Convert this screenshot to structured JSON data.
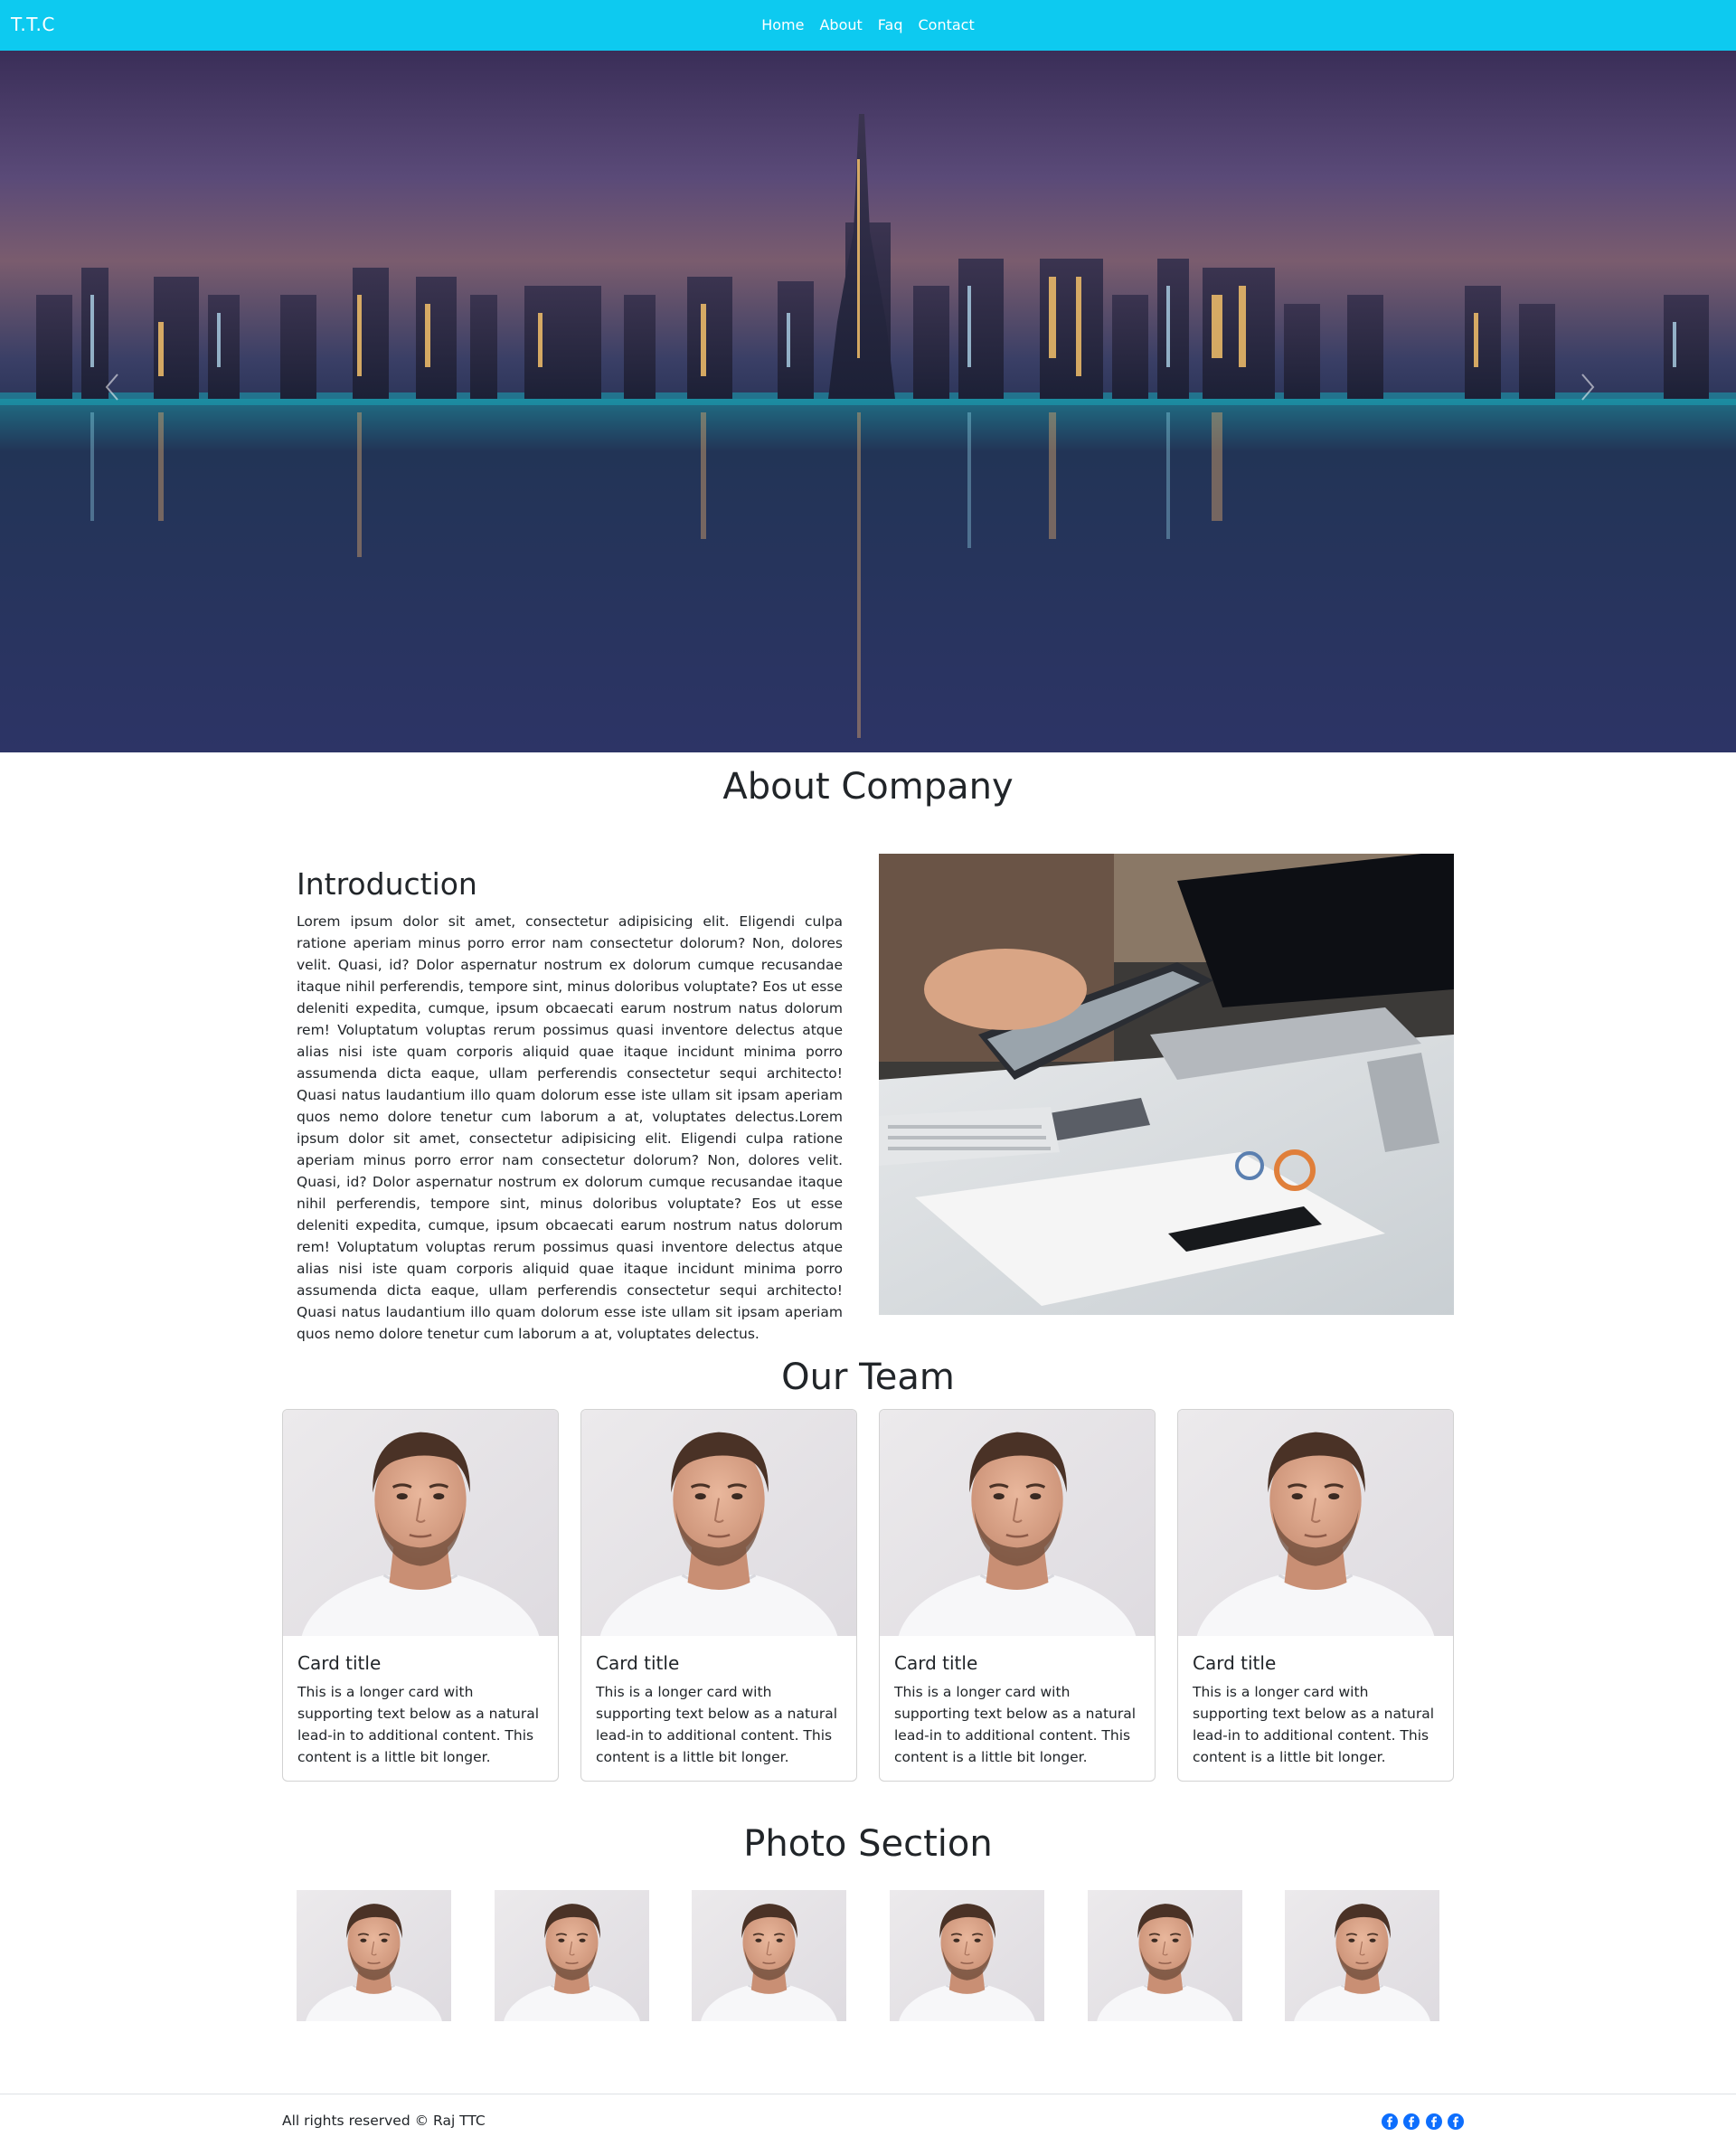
{
  "nav": {
    "brand": "T.T.C",
    "links": [
      "Home",
      "About",
      "Faq",
      "Contact"
    ]
  },
  "hero": {
    "prev_icon": "chevron-left-icon",
    "next_icon": "chevron-right-icon"
  },
  "about": {
    "title": "About Company",
    "intro_heading": "Introduction",
    "intro_text": "Lorem ipsum dolor sit amet, consectetur adipisicing elit. Eligendi culpa ratione aperiam minus porro error nam consectetur dolorum? Non, dolores velit. Quasi, id? Dolor aspernatur nostrum ex dolorum cumque recusandae itaque nihil perferendis, tempore sint, minus doloribus voluptate? Eos ut esse deleniti expedita, cumque, ipsum obcaecati earum nostrum natus dolorum rem! Voluptatum voluptas rerum possimus quasi inventore delectus atque alias nisi iste quam corporis aliquid quae itaque incidunt minima porro assumenda dicta eaque, ullam perferendis consectetur sequi architecto! Quasi natus laudantium illo quam dolorum esse iste ullam sit ipsam aperiam quos nemo dolore tenetur cum laborum a at, voluptates delectus.Lorem ipsum dolor sit amet, consectetur adipisicing elit. Eligendi culpa ratione aperiam minus porro error nam consectetur dolorum? Non, dolores velit. Quasi, id? Dolor aspernatur nostrum ex dolorum cumque recusandae itaque nihil perferendis, tempore sint, minus doloribus voluptate? Eos ut esse deleniti expedita, cumque, ipsum obcaecati earum nostrum natus dolorum rem! Voluptatum voluptas rerum possimus quasi inventore delectus atque alias nisi iste quam corporis aliquid quae itaque incidunt minima porro assumenda dicta eaque, ullam perferendis consectetur sequi architecto! Quasi natus laudantium illo quam dolorum esse iste ullam sit ipsam aperiam quos nemo dolore tenetur cum laborum a at, voluptates delectus."
  },
  "team": {
    "title": "Our Team",
    "cards": [
      {
        "title": "Card title",
        "text": "This is a longer card with supporting text below as a natural lead-in to additional content. This content is a little bit longer."
      },
      {
        "title": "Card title",
        "text": "This is a longer card with supporting text below as a natural lead-in to additional content. This content is a little bit longer."
      },
      {
        "title": "Card title",
        "text": "This is a longer card with supporting text below as a natural lead-in to additional content. This content is a little bit longer."
      },
      {
        "title": "Card title",
        "text": "This is a longer card with supporting text below as a natural lead-in to additional content. This content is a little bit longer."
      }
    ]
  },
  "photos": {
    "title": "Photo Section",
    "count": 6
  },
  "footer": {
    "text": "All rights reserved © Raj TTC",
    "social_icons": [
      "facebook-icon",
      "facebook-icon",
      "facebook-icon",
      "facebook-icon"
    ]
  },
  "colors": {
    "navbar": "#0dcaf0",
    "social": "#0d6efd",
    "text": "#212529"
  }
}
